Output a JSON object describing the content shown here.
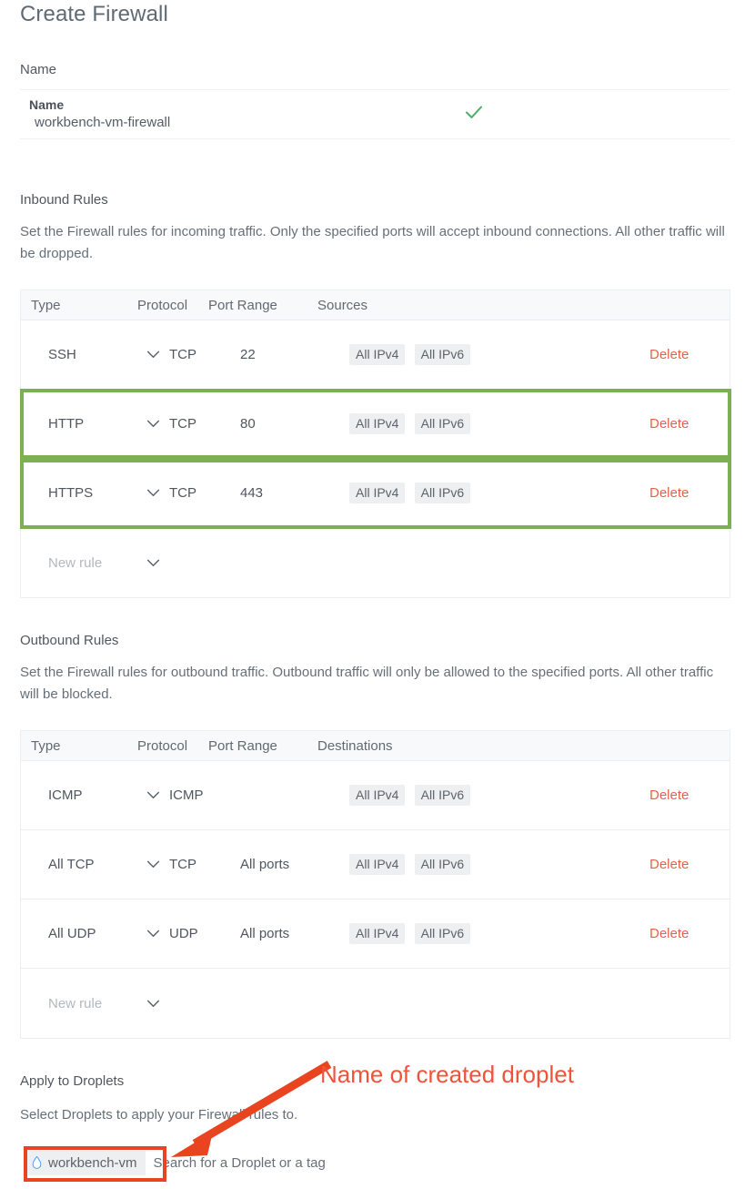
{
  "page": {
    "title": "Create Firewall"
  },
  "name_section": {
    "label": "Name",
    "field_title": "Name",
    "field_value": "workbench-vm-firewall",
    "valid_icon": "check-icon",
    "valid_color": "#4caf68"
  },
  "inbound": {
    "title": "Inbound Rules",
    "description": "Set the Firewall rules for incoming traffic. Only the specified ports will accept inbound connections. All other traffic will be dropped.",
    "columns": [
      "Type",
      "Protocol",
      "Port Range",
      "Sources"
    ],
    "rows": [
      {
        "type": "SSH",
        "protocol": "TCP",
        "port_range": "22",
        "sources": [
          "All IPv4",
          "All IPv6"
        ],
        "delete_label": "Delete",
        "highlighted": false
      },
      {
        "type": "HTTP",
        "protocol": "TCP",
        "port_range": "80",
        "sources": [
          "All IPv4",
          "All IPv6"
        ],
        "delete_label": "Delete",
        "highlighted": true
      },
      {
        "type": "HTTPS",
        "protocol": "TCP",
        "port_range": "443",
        "sources": [
          "All IPv4",
          "All IPv6"
        ],
        "delete_label": "Delete",
        "highlighted": true
      }
    ],
    "new_rule_label": "New rule"
  },
  "outbound": {
    "title": "Outbound Rules",
    "description": "Set the Firewall rules for outbound traffic. Outbound traffic will only be allowed to the specified ports. All other traffic will be blocked.",
    "columns": [
      "Type",
      "Protocol",
      "Port Range",
      "Destinations"
    ],
    "rows": [
      {
        "type": "ICMP",
        "protocol": "ICMP",
        "port_range": "",
        "destinations": [
          "All IPv4",
          "All IPv6"
        ],
        "delete_label": "Delete",
        "highlighted": false
      },
      {
        "type": "All TCP",
        "protocol": "TCP",
        "port_range": "All ports",
        "destinations": [
          "All IPv4",
          "All IPv6"
        ],
        "delete_label": "Delete",
        "highlighted": false
      },
      {
        "type": "All UDP",
        "protocol": "UDP",
        "port_range": "All ports",
        "destinations": [
          "All IPv4",
          "All IPv6"
        ],
        "delete_label": "Delete",
        "highlighted": false
      }
    ],
    "new_rule_label": "New rule"
  },
  "apply_to_droplets": {
    "title": "Apply to Droplets",
    "description": "Select Droplets to apply your Firewall rules to.",
    "selected_chips": [
      "workbench-vm"
    ],
    "search_placeholder": "Search for a Droplet or a tag"
  },
  "annotations": {
    "arrow_text": "Name of created droplet",
    "arrow_color": "#e8441f",
    "text_color": "#f0523c",
    "highlight_green": "#7cb052",
    "highlight_red": "#e8441f"
  }
}
